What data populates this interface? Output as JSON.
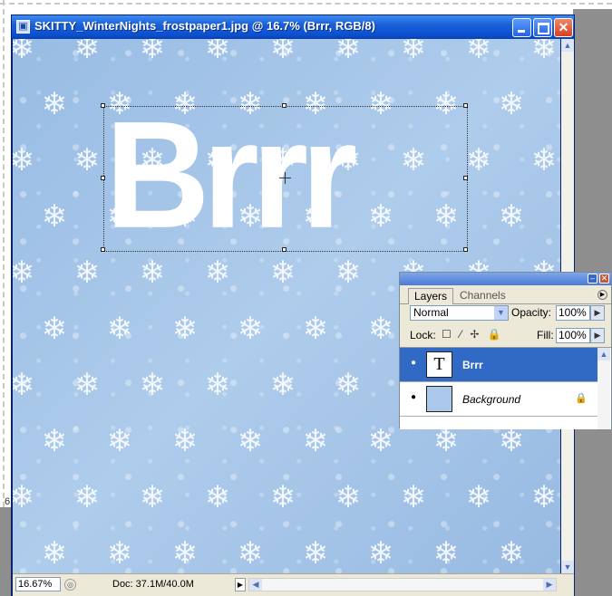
{
  "window": {
    "title": "SKITTY_WinterNights_frostpaper1.jpg @ 16.7% (Brrr, RGB/8)",
    "minimize_glyph": "",
    "close_glyph": "✕"
  },
  "canvas": {
    "text_layer_content": "Brrr",
    "background_color": "#a9c8ea"
  },
  "statusbar": {
    "zoom": "16.67%",
    "doc_size": "Doc: 37.1M/40.0M",
    "menu_arrow": "▶"
  },
  "side_fragment": "6",
  "layers_panel": {
    "tabs": [
      "Layers",
      "Channels"
    ],
    "blend_mode": "Normal",
    "opacity_label": "Opacity:",
    "opacity_value": "100%",
    "lock_label": "Lock:",
    "lock_icons": "☐ ⁄ ✢ 🔒",
    "fill_label": "Fill:",
    "fill_value": "100%",
    "layers": [
      {
        "name": "Brrr",
        "thumb_glyph": "T",
        "selected": true
      },
      {
        "name": "Background",
        "locked_glyph": "🔒",
        "selected": false
      }
    ],
    "eye_glyph": "●"
  },
  "icons": {
    "app": "photoshop-doc-icon",
    "minimize": "minimize-icon",
    "maximize": "maximize-icon",
    "close": "close-icon",
    "eye": "eye-icon",
    "lock": "lock-icon"
  }
}
